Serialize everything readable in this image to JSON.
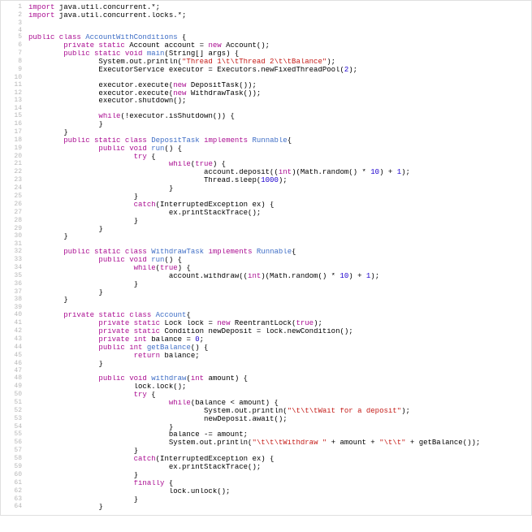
{
  "lines": [
    {
      "n": 1,
      "tokens": [
        [
          "kw",
          "import"
        ],
        [
          "plain",
          " java.util.concurrent.*;"
        ]
      ]
    },
    {
      "n": 2,
      "tokens": [
        [
          "kw",
          "import"
        ],
        [
          "plain",
          " java.util.concurrent.locks.*;"
        ]
      ]
    },
    {
      "n": 3,
      "tokens": [
        [
          "plain",
          ""
        ]
      ]
    },
    {
      "n": 4,
      "tokens": [
        [
          "plain",
          ""
        ]
      ]
    },
    {
      "n": 5,
      "tokens": [
        [
          "kw",
          "public class"
        ],
        [
          "plain",
          " "
        ],
        [
          "cls",
          "AccountWithConditions"
        ],
        [
          "plain",
          " {"
        ]
      ]
    },
    {
      "n": 6,
      "tokens": [
        [
          "plain",
          "        "
        ],
        [
          "kw",
          "private static"
        ],
        [
          "plain",
          " Account account = "
        ],
        [
          "kw",
          "new"
        ],
        [
          "plain",
          " Account();"
        ]
      ]
    },
    {
      "n": 7,
      "tokens": [
        [
          "plain",
          "        "
        ],
        [
          "kw",
          "public static void"
        ],
        [
          "plain",
          " "
        ],
        [
          "cls",
          "main"
        ],
        [
          "plain",
          "(String[] args) {"
        ]
      ]
    },
    {
      "n": 8,
      "tokens": [
        [
          "plain",
          "                System.out.println("
        ],
        [
          "str",
          "\"Thread 1\\t\\tThread 2\\t\\tBalance\""
        ],
        [
          "plain",
          ");"
        ]
      ]
    },
    {
      "n": 9,
      "tokens": [
        [
          "plain",
          "                ExecutorService executor = Executors.newFixedThreadPool("
        ],
        [
          "num",
          "2"
        ],
        [
          "plain",
          ");"
        ]
      ]
    },
    {
      "n": 10,
      "tokens": [
        [
          "plain",
          ""
        ]
      ]
    },
    {
      "n": 11,
      "tokens": [
        [
          "plain",
          "                executor.execute("
        ],
        [
          "kw",
          "new"
        ],
        [
          "plain",
          " DepositTask());"
        ]
      ]
    },
    {
      "n": 12,
      "tokens": [
        [
          "plain",
          "                executor.execute("
        ],
        [
          "kw",
          "new"
        ],
        [
          "plain",
          " WithdrawTask());"
        ]
      ]
    },
    {
      "n": 13,
      "tokens": [
        [
          "plain",
          "                executor.shutdown();"
        ]
      ]
    },
    {
      "n": 14,
      "tokens": [
        [
          "plain",
          ""
        ]
      ]
    },
    {
      "n": 15,
      "tokens": [
        [
          "plain",
          "                "
        ],
        [
          "kw",
          "while"
        ],
        [
          "plain",
          "(!executor.isShutdown()) {"
        ]
      ]
    },
    {
      "n": 16,
      "tokens": [
        [
          "plain",
          "                }"
        ]
      ]
    },
    {
      "n": 17,
      "tokens": [
        [
          "plain",
          "        }"
        ]
      ]
    },
    {
      "n": 18,
      "tokens": [
        [
          "plain",
          "        "
        ],
        [
          "kw",
          "public static class"
        ],
        [
          "plain",
          " "
        ],
        [
          "cls",
          "DepositTask"
        ],
        [
          "plain",
          " "
        ],
        [
          "kw",
          "implements"
        ],
        [
          "plain",
          " "
        ],
        [
          "cls",
          "Runnable"
        ],
        [
          "plain",
          "{"
        ]
      ]
    },
    {
      "n": 19,
      "tokens": [
        [
          "plain",
          "                "
        ],
        [
          "kw",
          "public void"
        ],
        [
          "plain",
          " "
        ],
        [
          "cls",
          "run"
        ],
        [
          "plain",
          "() {"
        ]
      ]
    },
    {
      "n": 20,
      "tokens": [
        [
          "plain",
          "                        "
        ],
        [
          "kw",
          "try"
        ],
        [
          "plain",
          " {"
        ]
      ]
    },
    {
      "n": 21,
      "tokens": [
        [
          "plain",
          "                                "
        ],
        [
          "kw",
          "while"
        ],
        [
          "plain",
          "("
        ],
        [
          "bool",
          "true"
        ],
        [
          "plain",
          ") {"
        ]
      ]
    },
    {
      "n": 22,
      "tokens": [
        [
          "plain",
          "                                        account.deposit(("
        ],
        [
          "kw",
          "int"
        ],
        [
          "plain",
          ")(Math.random() * "
        ],
        [
          "num",
          "10"
        ],
        [
          "plain",
          ") + "
        ],
        [
          "num",
          "1"
        ],
        [
          "plain",
          ");"
        ]
      ]
    },
    {
      "n": 23,
      "tokens": [
        [
          "plain",
          "                                        Thread.sleep("
        ],
        [
          "num",
          "1000"
        ],
        [
          "plain",
          ");"
        ]
      ]
    },
    {
      "n": 24,
      "tokens": [
        [
          "plain",
          "                                }"
        ]
      ]
    },
    {
      "n": 25,
      "tokens": [
        [
          "plain",
          "                        }"
        ]
      ]
    },
    {
      "n": 26,
      "tokens": [
        [
          "plain",
          "                        "
        ],
        [
          "kw",
          "catch"
        ],
        [
          "plain",
          "(InterruptedException ex) {"
        ]
      ]
    },
    {
      "n": 27,
      "tokens": [
        [
          "plain",
          "                                ex.printStackTrace();"
        ]
      ]
    },
    {
      "n": 28,
      "tokens": [
        [
          "plain",
          "                        }"
        ]
      ]
    },
    {
      "n": 29,
      "tokens": [
        [
          "plain",
          "                }"
        ]
      ]
    },
    {
      "n": 30,
      "tokens": [
        [
          "plain",
          "        }"
        ]
      ]
    },
    {
      "n": 31,
      "tokens": [
        [
          "plain",
          ""
        ]
      ]
    },
    {
      "n": 32,
      "tokens": [
        [
          "plain",
          "        "
        ],
        [
          "kw",
          "public static class"
        ],
        [
          "plain",
          " "
        ],
        [
          "cls",
          "WithdrawTask"
        ],
        [
          "plain",
          " "
        ],
        [
          "kw",
          "implements"
        ],
        [
          "plain",
          " "
        ],
        [
          "cls",
          "Runnable"
        ],
        [
          "plain",
          "{"
        ]
      ]
    },
    {
      "n": 33,
      "tokens": [
        [
          "plain",
          "                "
        ],
        [
          "kw",
          "public void"
        ],
        [
          "plain",
          " "
        ],
        [
          "cls",
          "run"
        ],
        [
          "plain",
          "() {"
        ]
      ]
    },
    {
      "n": 34,
      "tokens": [
        [
          "plain",
          "                        "
        ],
        [
          "kw",
          "while"
        ],
        [
          "plain",
          "("
        ],
        [
          "bool",
          "true"
        ],
        [
          "plain",
          ") {"
        ]
      ]
    },
    {
      "n": 35,
      "tokens": [
        [
          "plain",
          "                                account.withdraw(("
        ],
        [
          "kw",
          "int"
        ],
        [
          "plain",
          ")(Math.random() * "
        ],
        [
          "num",
          "10"
        ],
        [
          "plain",
          ") + "
        ],
        [
          "num",
          "1"
        ],
        [
          "plain",
          ");"
        ]
      ]
    },
    {
      "n": 36,
      "tokens": [
        [
          "plain",
          "                        }"
        ]
      ]
    },
    {
      "n": 37,
      "tokens": [
        [
          "plain",
          "                }"
        ]
      ]
    },
    {
      "n": 38,
      "tokens": [
        [
          "plain",
          "        }"
        ]
      ]
    },
    {
      "n": 39,
      "tokens": [
        [
          "plain",
          ""
        ]
      ]
    },
    {
      "n": 40,
      "tokens": [
        [
          "plain",
          "        "
        ],
        [
          "kw",
          "private static class"
        ],
        [
          "plain",
          " "
        ],
        [
          "cls",
          "Account"
        ],
        [
          "plain",
          "{"
        ]
      ]
    },
    {
      "n": 41,
      "tokens": [
        [
          "plain",
          "                "
        ],
        [
          "kw",
          "private static"
        ],
        [
          "plain",
          " Lock lock = "
        ],
        [
          "kw",
          "new"
        ],
        [
          "plain",
          " ReentrantLock("
        ],
        [
          "bool",
          "true"
        ],
        [
          "plain",
          ");"
        ]
      ]
    },
    {
      "n": 42,
      "tokens": [
        [
          "plain",
          "                "
        ],
        [
          "kw",
          "private static"
        ],
        [
          "plain",
          " Condition newDeposit = lock.newCondition();"
        ]
      ]
    },
    {
      "n": 43,
      "tokens": [
        [
          "plain",
          "                "
        ],
        [
          "kw",
          "private int"
        ],
        [
          "plain",
          " balance = "
        ],
        [
          "num",
          "0"
        ],
        [
          "plain",
          ";"
        ]
      ]
    },
    {
      "n": 44,
      "tokens": [
        [
          "plain",
          "                "
        ],
        [
          "kw",
          "public int"
        ],
        [
          "plain",
          " "
        ],
        [
          "cls",
          "getBalance"
        ],
        [
          "plain",
          "() {"
        ]
      ]
    },
    {
      "n": 45,
      "tokens": [
        [
          "plain",
          "                        "
        ],
        [
          "kw",
          "return"
        ],
        [
          "plain",
          " balance;"
        ]
      ]
    },
    {
      "n": 46,
      "tokens": [
        [
          "plain",
          "                }"
        ]
      ]
    },
    {
      "n": 47,
      "tokens": [
        [
          "plain",
          ""
        ]
      ]
    },
    {
      "n": 48,
      "tokens": [
        [
          "plain",
          "                "
        ],
        [
          "kw",
          "public void"
        ],
        [
          "plain",
          " "
        ],
        [
          "cls",
          "withdraw"
        ],
        [
          "plain",
          "("
        ],
        [
          "kw",
          "int"
        ],
        [
          "plain",
          " amount) {"
        ]
      ]
    },
    {
      "n": 49,
      "tokens": [
        [
          "plain",
          "                        lock.lock();"
        ]
      ]
    },
    {
      "n": 50,
      "tokens": [
        [
          "plain",
          "                        "
        ],
        [
          "kw",
          "try"
        ],
        [
          "plain",
          " {"
        ]
      ]
    },
    {
      "n": 51,
      "tokens": [
        [
          "plain",
          "                                "
        ],
        [
          "kw",
          "while"
        ],
        [
          "plain",
          "(balance < amount) {"
        ]
      ]
    },
    {
      "n": 52,
      "tokens": [
        [
          "plain",
          "                                        System.out.println("
        ],
        [
          "str",
          "\"\\t\\t\\tWait for a deposit\""
        ],
        [
          "plain",
          ");"
        ]
      ]
    },
    {
      "n": 53,
      "tokens": [
        [
          "plain",
          "                                        newDeposit.await();"
        ]
      ]
    },
    {
      "n": 54,
      "tokens": [
        [
          "plain",
          "                                }"
        ]
      ]
    },
    {
      "n": 55,
      "tokens": [
        [
          "plain",
          "                                balance -= amount;"
        ]
      ]
    },
    {
      "n": 56,
      "tokens": [
        [
          "plain",
          "                                System.out.println("
        ],
        [
          "str",
          "\"\\t\\t\\tWithdraw \""
        ],
        [
          "plain",
          " + amount + "
        ],
        [
          "str",
          "\"\\t\\t\""
        ],
        [
          "plain",
          " + getBalance());"
        ]
      ]
    },
    {
      "n": 57,
      "tokens": [
        [
          "plain",
          "                        }"
        ]
      ]
    },
    {
      "n": 58,
      "tokens": [
        [
          "plain",
          "                        "
        ],
        [
          "kw",
          "catch"
        ],
        [
          "plain",
          "(InterruptedException ex) {"
        ]
      ]
    },
    {
      "n": 59,
      "tokens": [
        [
          "plain",
          "                                ex.printStackTrace();"
        ]
      ]
    },
    {
      "n": 60,
      "tokens": [
        [
          "plain",
          "                        }"
        ]
      ]
    },
    {
      "n": 61,
      "tokens": [
        [
          "plain",
          "                        "
        ],
        [
          "kw",
          "finally"
        ],
        [
          "plain",
          " {"
        ]
      ]
    },
    {
      "n": 62,
      "tokens": [
        [
          "plain",
          "                                lock.unlock();"
        ]
      ]
    },
    {
      "n": 63,
      "tokens": [
        [
          "plain",
          "                        }"
        ]
      ]
    },
    {
      "n": 64,
      "tokens": [
        [
          "plain",
          "                }"
        ]
      ]
    }
  ]
}
